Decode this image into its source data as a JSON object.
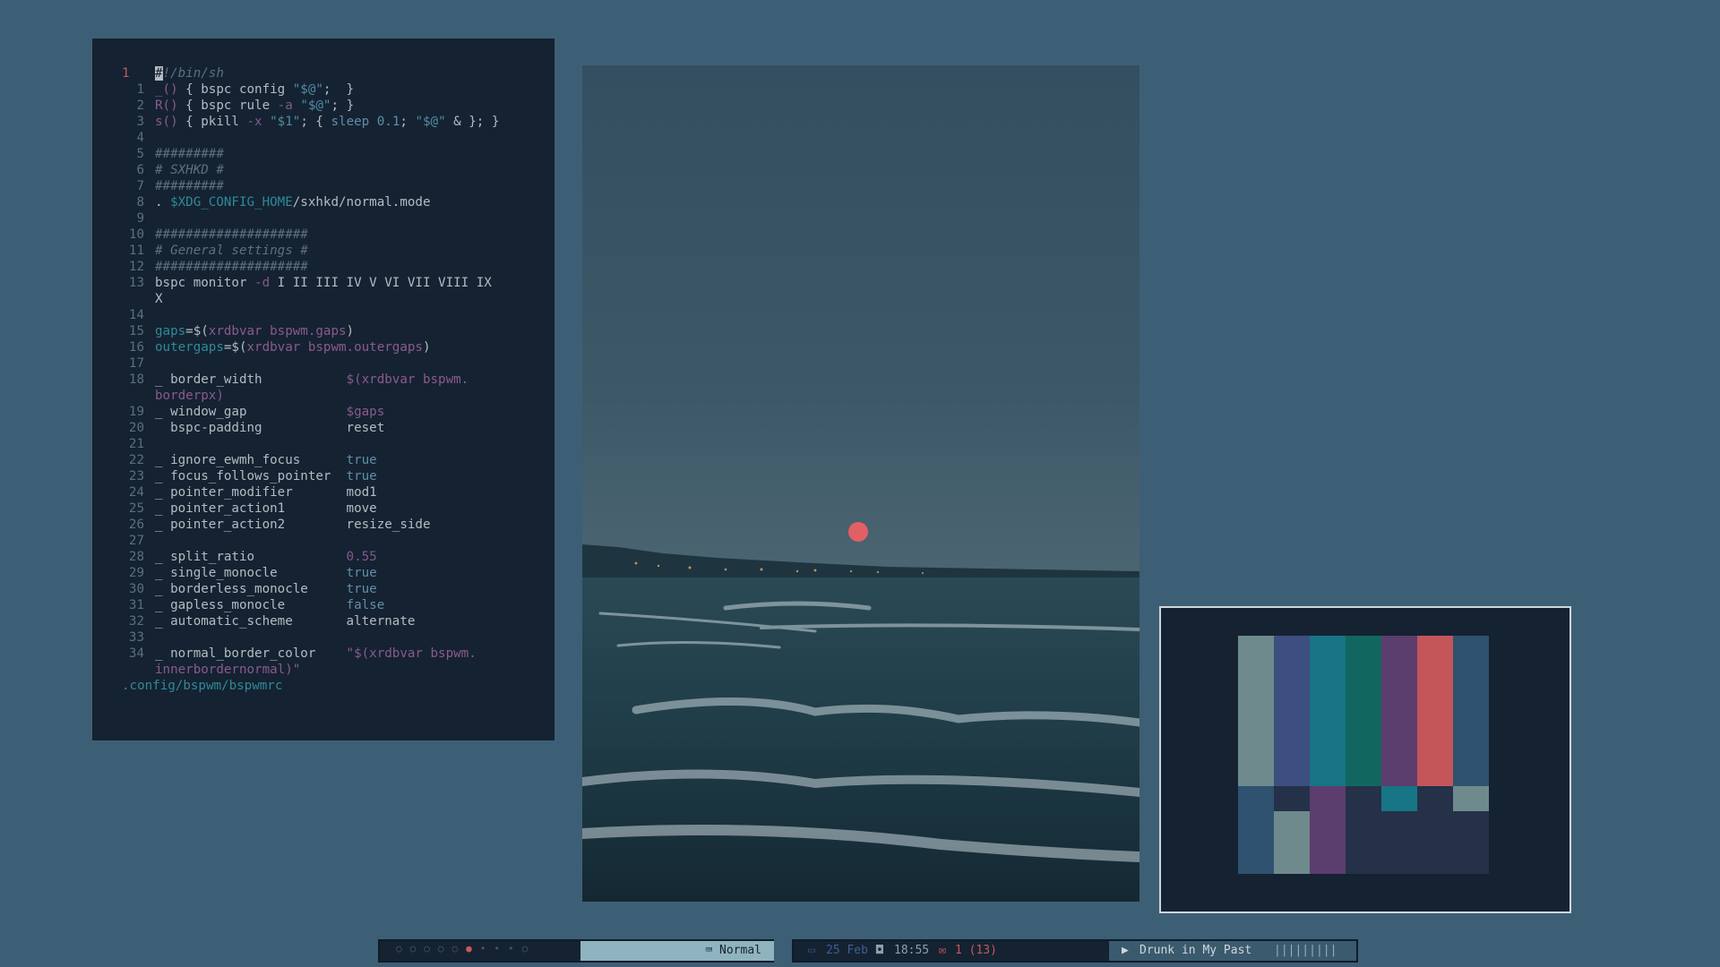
{
  "editor": {
    "current_line": "1",
    "lines": [
      {
        "num": "1",
        "segments": [
          {
            "t": "_()",
            "c": "fn"
          },
          {
            "t": " { bspc config ",
            "c": ""
          },
          {
            "t": "\"$@\"",
            "c": "str"
          },
          {
            "t": ";  }",
            "c": ""
          }
        ]
      },
      {
        "num": "2",
        "segments": [
          {
            "t": "R()",
            "c": "fn"
          },
          {
            "t": " { bspc rule ",
            "c": ""
          },
          {
            "t": "-a",
            "c": "kw"
          },
          {
            "t": " ",
            "c": ""
          },
          {
            "t": "\"$@\"",
            "c": "str"
          },
          {
            "t": "; }",
            "c": ""
          }
        ]
      },
      {
        "num": "3",
        "segments": [
          {
            "t": "s()",
            "c": "fn"
          },
          {
            "t": " { pkill ",
            "c": ""
          },
          {
            "t": "-x",
            "c": "kw"
          },
          {
            "t": " ",
            "c": ""
          },
          {
            "t": "\"$1\"",
            "c": "str"
          },
          {
            "t": "; { ",
            "c": ""
          },
          {
            "t": "sleep 0.1",
            "c": "val"
          },
          {
            "t": "; ",
            "c": ""
          },
          {
            "t": "\"$@\"",
            "c": "str"
          },
          {
            "t": " & }; }",
            "c": ""
          }
        ]
      },
      {
        "num": "4",
        "segments": []
      },
      {
        "num": "5",
        "segments": [
          {
            "t": "#########",
            "c": "cmt"
          }
        ]
      },
      {
        "num": "6",
        "segments": [
          {
            "t": "# SXHKD #",
            "c": "cmt"
          }
        ]
      },
      {
        "num": "7",
        "segments": [
          {
            "t": "#########",
            "c": "cmt"
          }
        ]
      },
      {
        "num": "8",
        "segments": [
          {
            "t": ". ",
            "c": ""
          },
          {
            "t": "$XDG_CONFIG_HOME",
            "c": "var"
          },
          {
            "t": "/sxhkd/normal.mode",
            "c": ""
          }
        ]
      },
      {
        "num": "9",
        "segments": []
      },
      {
        "num": "10",
        "segments": [
          {
            "t": "####################",
            "c": "cmt"
          }
        ]
      },
      {
        "num": "11",
        "segments": [
          {
            "t": "# General settings #",
            "c": "cmt"
          }
        ]
      },
      {
        "num": "12",
        "segments": [
          {
            "t": "####################",
            "c": "cmt"
          }
        ]
      },
      {
        "num": "13",
        "segments": [
          {
            "t": "bspc monitor ",
            "c": ""
          },
          {
            "t": "-d",
            "c": "kw"
          },
          {
            "t": " I II III IV V VI VII VIII IX",
            "c": ""
          }
        ]
      },
      {
        "num": "",
        "segments": [
          {
            "t": "X",
            "c": ""
          }
        ]
      },
      {
        "num": "14",
        "segments": []
      },
      {
        "num": "15",
        "segments": [
          {
            "t": "gaps",
            "c": "var"
          },
          {
            "t": "=$(",
            "c": ""
          },
          {
            "t": "xrdbvar bspwm.gaps",
            "c": "fn"
          },
          {
            "t": ")",
            "c": ""
          }
        ]
      },
      {
        "num": "16",
        "segments": [
          {
            "t": "outergaps",
            "c": "var"
          },
          {
            "t": "=$(",
            "c": ""
          },
          {
            "t": "xrdbvar bspwm.outergaps",
            "c": "fn"
          },
          {
            "t": ")",
            "c": ""
          }
        ]
      },
      {
        "num": "17",
        "segments": []
      },
      {
        "num": "18",
        "segments": [
          {
            "t": "_ border_width           ",
            "c": ""
          },
          {
            "t": "$(xrdbvar bspwm.",
            "c": "fn"
          }
        ]
      },
      {
        "num": "",
        "segments": [
          {
            "t": "borderpx)",
            "c": "fn"
          }
        ]
      },
      {
        "num": "19",
        "segments": [
          {
            "t": "_ window_gap             ",
            "c": ""
          },
          {
            "t": "$gaps",
            "c": "fn"
          }
        ]
      },
      {
        "num": "20",
        "segments": [
          {
            "t": "  bspc-padding           reset",
            "c": ""
          }
        ]
      },
      {
        "num": "21",
        "segments": []
      },
      {
        "num": "22",
        "segments": [
          {
            "t": "_ ignore_ewmh_focus      ",
            "c": ""
          },
          {
            "t": "true",
            "c": "val"
          }
        ]
      },
      {
        "num": "23",
        "segments": [
          {
            "t": "_ focus_follows_pointer  ",
            "c": ""
          },
          {
            "t": "true",
            "c": "val"
          }
        ]
      },
      {
        "num": "24",
        "segments": [
          {
            "t": "_ pointer_modifier       mod1",
            "c": ""
          }
        ]
      },
      {
        "num": "25",
        "segments": [
          {
            "t": "_ pointer_action1        move",
            "c": ""
          }
        ]
      },
      {
        "num": "26",
        "segments": [
          {
            "t": "_ pointer_action2        resize_side",
            "c": ""
          }
        ]
      },
      {
        "num": "27",
        "segments": []
      },
      {
        "num": "28",
        "segments": [
          {
            "t": "_ split_ratio            ",
            "c": ""
          },
          {
            "t": "0.55",
            "c": "kw"
          }
        ]
      },
      {
        "num": "29",
        "segments": [
          {
            "t": "_ single_monocle         ",
            "c": ""
          },
          {
            "t": "true",
            "c": "val"
          }
        ]
      },
      {
        "num": "30",
        "segments": [
          {
            "t": "_ borderless_monocle     ",
            "c": ""
          },
          {
            "t": "true",
            "c": "val"
          }
        ]
      },
      {
        "num": "31",
        "segments": [
          {
            "t": "_ gapless_monocle        ",
            "c": ""
          },
          {
            "t": "false",
            "c": "val"
          }
        ]
      },
      {
        "num": "32",
        "segments": [
          {
            "t": "_ automatic_scheme       alternate",
            "c": ""
          }
        ]
      },
      {
        "num": "33",
        "segments": []
      },
      {
        "num": "34",
        "segments": [
          {
            "t": "_ normal_border_color    ",
            "c": ""
          },
          {
            "t": "\"$(xrdbvar bspwm.",
            "c": "fn"
          }
        ]
      },
      {
        "num": "",
        "segments": [
          {
            "t": "innerbordernormal)\"",
            "c": "fn"
          }
        ]
      }
    ],
    "shebang": "#!/bin/sh",
    "file_path": ".config/bspwm/bspwmrc"
  },
  "palette": {
    "top_colors": [
      "#6e8a8c",
      "#3d4e80",
      "#177585",
      "#11675f",
      "#5b3d6e",
      "#c4565a",
      "#2e5270"
    ],
    "bottom_colors": [
      "#2e5270",
      "#243148",
      "#5b3d6e",
      "#243148",
      "#177585",
      "#243148",
      "#6e8a8c"
    ],
    "lower_colors": [
      "#2e5270",
      "#6e8a8c",
      "#5b3d6e",
      "#243148",
      "#243148",
      "#243148",
      "#243148"
    ]
  },
  "bar": {
    "workspaces": [
      "○",
      "○",
      "○",
      "○",
      "○",
      "●",
      "•",
      "•",
      "•",
      "○"
    ],
    "active_index": 5,
    "mode_icon": "keyboard-icon",
    "mode_label": "Normal",
    "date_icon": "calendar-icon",
    "date": "25 Feb",
    "time_icon": "clock-icon",
    "time": "18:55",
    "mail_icon": "mail-icon",
    "mail": "1 (13)",
    "play_icon": "play-icon",
    "track": "Drunk in My Past",
    "volume": "|||||||||"
  }
}
